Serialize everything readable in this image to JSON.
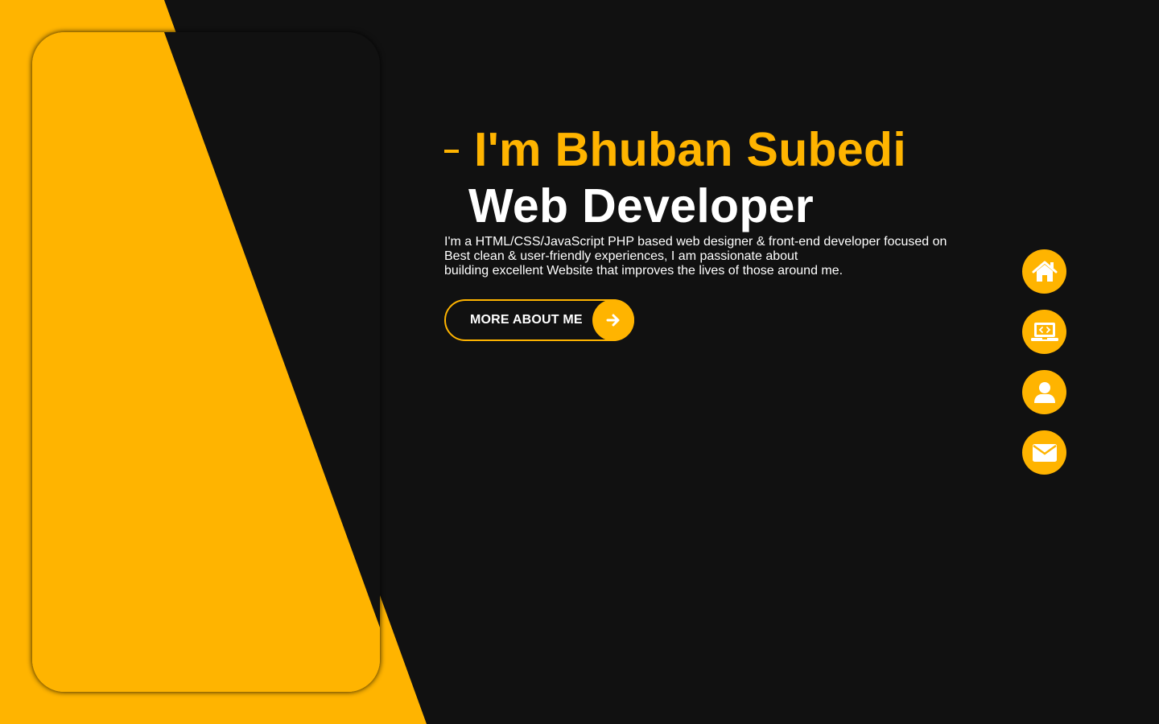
{
  "colors": {
    "accent": "#ffb400",
    "background": "#111111",
    "text": "#ffffff"
  },
  "hero": {
    "name": "I'm Bhuban Subedi",
    "role": "Web Developer",
    "bio_lines": [
      "I'm a HTML/CSS/JavaScript PHP based web designer & front-end developer focused on",
      "Best clean & user-friendly experiences, I am passionate about",
      "building excellent Website that improves the lives of those around me."
    ],
    "more_button": {
      "label": "MORE ABOUT ME",
      "icon": "arrow-right-icon"
    }
  },
  "side_nav": [
    {
      "icon": "home-icon",
      "target": "home"
    },
    {
      "icon": "laptop-code-icon",
      "target": "portfolio"
    },
    {
      "icon": "user-icon",
      "target": "about"
    },
    {
      "icon": "envelope-icon",
      "target": "contact"
    }
  ]
}
